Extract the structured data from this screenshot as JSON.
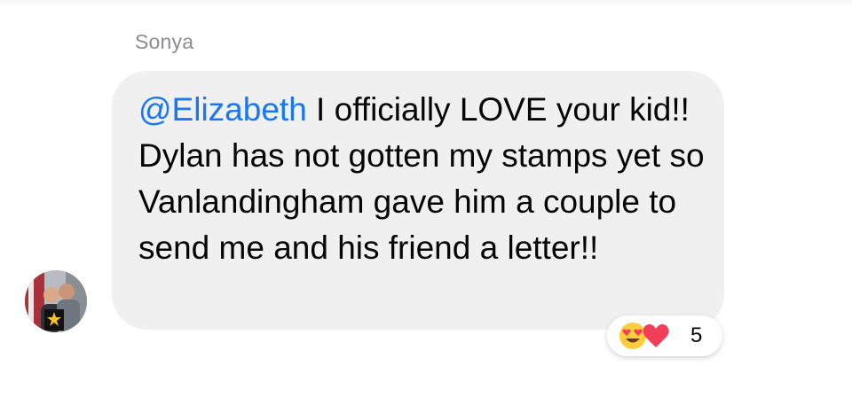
{
  "comment": {
    "author": "Sonya",
    "mention": "@Elizabeth",
    "text": " I officially LOVE your kid!! Dylan has not gotten my stamps yet so Vanlandingham gave him a couple to send me and his friend a letter!!"
  },
  "reactions": {
    "icons": [
      "heart-eyes-emoji-icon",
      "heart-icon"
    ],
    "count": "5"
  },
  "colors": {
    "bubble": "#f0f0f0",
    "mention": "#1877f2",
    "name": "#8a8d91",
    "heart": "#f33e58",
    "emoji": "#fbcd3c"
  }
}
